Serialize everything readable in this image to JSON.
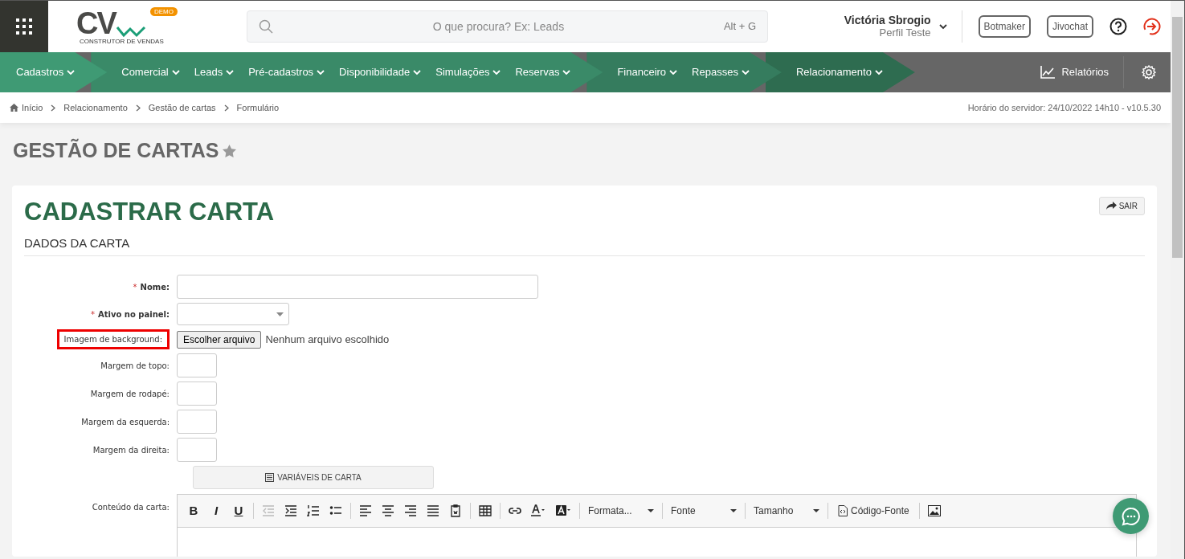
{
  "header": {
    "logo": {
      "text": "CV",
      "badge": "DEMO",
      "tagline": "CONSTRUTOR DE VENDAS"
    },
    "search": {
      "placeholder": "O que procura? Ex: Leads",
      "shortcut": "Alt + G"
    },
    "user": {
      "name": "Victória Sbrogio",
      "profile": "Perfil Teste"
    },
    "buttons": [
      "Botmaker",
      "Jivochat"
    ]
  },
  "nav": {
    "groups": [
      {
        "color": "#3f9a74",
        "items": [
          "Cadastros"
        ]
      },
      {
        "color": "#3a8a68",
        "items": [
          "Comercial",
          "Leads",
          "Pré-cadastros",
          "Disponibilidade",
          "Simulações",
          "Reservas"
        ]
      },
      {
        "color": "#357c5e",
        "items": [
          "Financeiro",
          "Repasses"
        ]
      },
      {
        "color": "#2e6c50",
        "items": [
          "Relacionamento"
        ]
      }
    ],
    "reports": "Relatórios"
  },
  "breadcrumb": {
    "items": [
      "Início",
      "Relacionamento",
      "Gestão de cartas",
      "Formulário"
    ],
    "server_time": "Horário do servidor: 24/10/2022 14h10 - v10.5.30"
  },
  "page_title": "GESTÃO DE CARTAS",
  "card": {
    "title": "CADASTRAR CARTA",
    "exit_button": "SAIR",
    "section": "DADOS DA CARTA",
    "fields": [
      {
        "kind": "text",
        "label": "Nome:",
        "required_mark": "*",
        "highlighted": false
      },
      {
        "kind": "select",
        "label": "Ativo no painel:",
        "required_mark": "*",
        "highlighted": false
      },
      {
        "kind": "file",
        "label": "Imagem de background:",
        "highlighted": true,
        "button": "Escolher arquivo",
        "status": "Nenhum arquivo escolhido"
      },
      {
        "kind": "small",
        "label": "Margem de topo:",
        "highlighted": false
      },
      {
        "kind": "small",
        "label": "Margem de rodapé:",
        "highlighted": false
      },
      {
        "kind": "small",
        "label": "Margem da esquerda:",
        "highlighted": false
      },
      {
        "kind": "small",
        "label": "Margem da direita:",
        "highlighted": false
      }
    ],
    "variables_button": "VARIÁVEIS DE CARTA",
    "content_label": "Conteúdo da carta:",
    "toolbar": [
      {
        "kind": "letter",
        "label": "B",
        "disabled": false
      },
      {
        "kind": "letter",
        "label": "I",
        "disabled": false
      },
      {
        "kind": "letter",
        "label": "U",
        "disabled": false
      },
      {
        "kind": "separator"
      },
      {
        "kind": "icon",
        "disabled": true
      },
      {
        "kind": "icon",
        "disabled": false
      },
      {
        "kind": "icon",
        "disabled": false
      },
      {
        "kind": "icon",
        "disabled": false
      },
      {
        "kind": "separator"
      },
      {
        "kind": "icon",
        "disabled": false
      },
      {
        "kind": "icon",
        "disabled": false
      },
      {
        "kind": "icon",
        "disabled": false
      },
      {
        "kind": "icon",
        "disabled": false
      },
      {
        "kind": "icon",
        "disabled": false
      },
      {
        "kind": "separator"
      },
      {
        "kind": "icon",
        "disabled": false
      },
      {
        "kind": "separator"
      },
      {
        "kind": "icon",
        "disabled": false
      },
      {
        "kind": "icon",
        "disabled": false
      },
      {
        "kind": "icon",
        "disabled": false
      },
      {
        "kind": "separator"
      },
      {
        "kind": "dropdown",
        "label": "Formata..."
      },
      {
        "kind": "separator"
      },
      {
        "kind": "dropdown",
        "label": "Fonte"
      },
      {
        "kind": "separator"
      },
      {
        "kind": "dropdown",
        "label": "Tamanho"
      },
      {
        "kind": "separator"
      },
      {
        "kind": "source",
        "label": "Código-Fonte"
      },
      {
        "kind": "separator"
      },
      {
        "kind": "icon",
        "disabled": false
      }
    ]
  }
}
